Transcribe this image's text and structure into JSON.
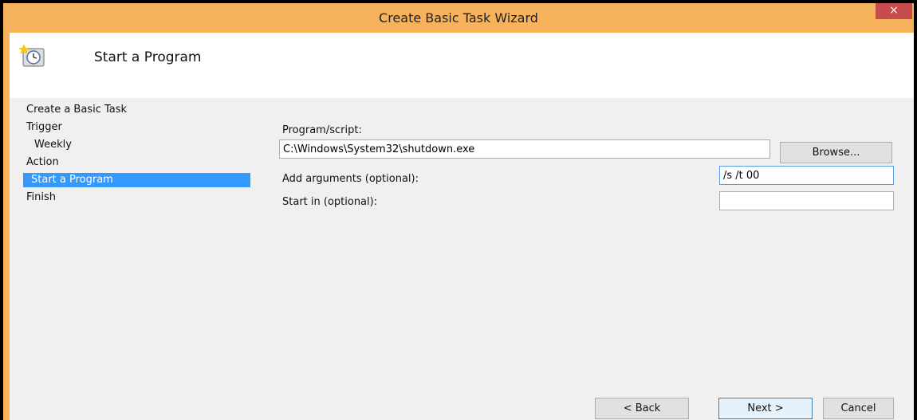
{
  "window": {
    "title": "Create Basic Task Wizard",
    "close_glyph": "×"
  },
  "header": {
    "title": "Start a Program",
    "icon": "task-scheduler-clock-icon"
  },
  "sidebar": {
    "items": [
      {
        "label": "Create a Basic Task"
      },
      {
        "label": "Trigger"
      },
      {
        "label": "Weekly"
      },
      {
        "label": "Action"
      },
      {
        "label": "Start a Program",
        "selected": true
      },
      {
        "label": "Finish"
      }
    ]
  },
  "form": {
    "program_label": "Program/script:",
    "program_value": "C:\\Windows\\System32\\shutdown.exe",
    "browse_label": "Browse...",
    "arguments_label": "Add arguments (optional):",
    "arguments_value": "/s /t 00",
    "startin_label": "Start in (optional):",
    "startin_value": ""
  },
  "footer": {
    "back_label": "< Back",
    "next_label": "Next >",
    "cancel_label": "Cancel"
  },
  "colors": {
    "titlebar": "#f7b25c",
    "close": "#c74d4d",
    "selection": "#3399ff"
  }
}
